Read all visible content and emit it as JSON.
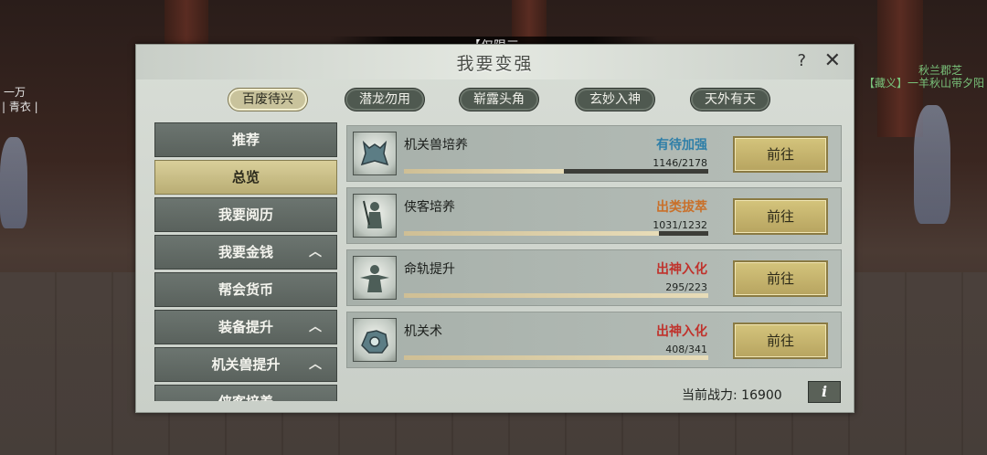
{
  "scene": {
    "names": [
      {
        "text": "【藏义】一羊秋山带夕阳",
        "color": "#79c27a"
      },
      {
        "text": "秋兰郡芝",
        "color": "#79c27a"
      },
      {
        "text": "一万",
        "color": "#e4e4e4"
      },
      {
        "text": "| 青衣 |",
        "color": "#e4e4e4"
      }
    ],
    "notice": "【仅限三"
  },
  "panel": {
    "title": "我要变强",
    "help": "?",
    "close": "✕"
  },
  "tabs": [
    "百废待兴",
    "潜龙勿用",
    "崭露头角",
    "玄妙入神",
    "天外有天"
  ],
  "sidebar": [
    {
      "label": "推荐",
      "caret": ""
    },
    {
      "label": "总览",
      "caret": ""
    },
    {
      "label": "我要阅历",
      "caret": ""
    },
    {
      "label": "我要金钱",
      "caret": "︿"
    },
    {
      "label": "帮会货币",
      "caret": ""
    },
    {
      "label": "装备提升",
      "caret": "︿"
    },
    {
      "label": "机关兽提升",
      "caret": "︿"
    },
    {
      "label": "侠客培养",
      "caret": "︿"
    }
  ],
  "rows": [
    {
      "label": "机关兽培养",
      "status": "有待加强",
      "status_color": "#2f7fa8",
      "count": "1146/2178",
      "progress": 0.526,
      "icon": "mechanical-beast-icon",
      "button": "前往"
    },
    {
      "label": "侠客培养",
      "status": "出类拔萃",
      "status_color": "#c9702a",
      "count": "1031/1232",
      "progress": 0.837,
      "icon": "swordsman-icon",
      "button": "前往"
    },
    {
      "label": "命轨提升",
      "status": "出神入化",
      "status_color": "#c0322c",
      "count": "295/223",
      "progress": 1.0,
      "icon": "deity-icon",
      "button": "前往"
    },
    {
      "label": "机关术",
      "status": "出神入化",
      "status_color": "#c0322c",
      "count": "408/341",
      "progress": 1.0,
      "icon": "mechanism-icon",
      "button": "前往"
    }
  ],
  "footer": {
    "power_label": "当前战力:",
    "power_value": "16900",
    "info": "i"
  }
}
